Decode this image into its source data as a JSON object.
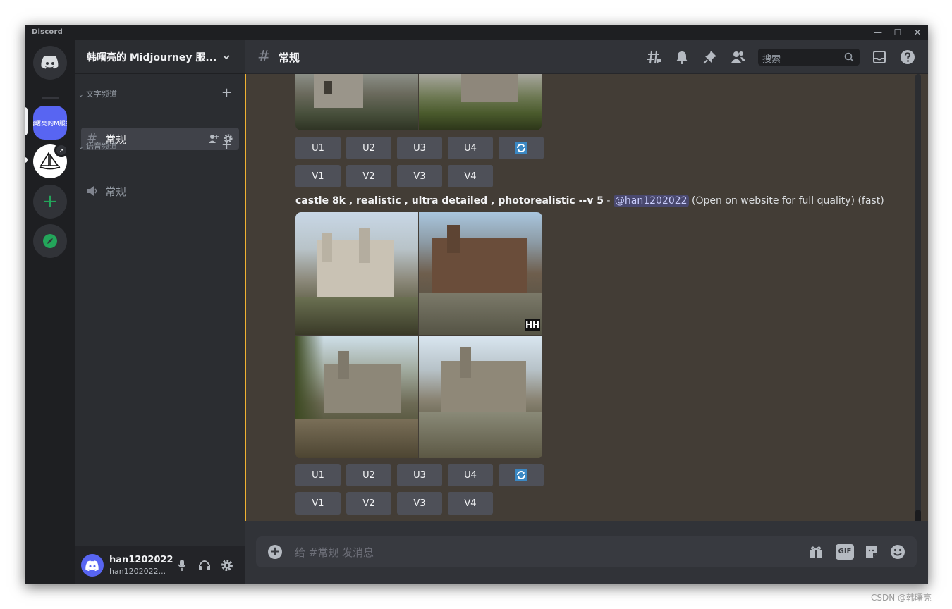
{
  "window": {
    "brand": "Discord",
    "controls": [
      "—",
      "☐",
      "✕"
    ]
  },
  "rail": {
    "servers": [
      {
        "kind": "home"
      },
      {
        "label": "翰曙亮的M服务"
      },
      {
        "kind": "midjourney"
      },
      {
        "kind": "add"
      },
      {
        "kind": "explore"
      }
    ]
  },
  "sidebar": {
    "guild_name": "韩曙亮的 Midjourney 服...",
    "categories": [
      {
        "label": "文字频道"
      },
      {
        "label": "语音频道"
      }
    ],
    "channels": [
      {
        "name": "常规",
        "type": "text",
        "selected": true
      },
      {
        "name": "常规",
        "type": "voice",
        "selected": false
      }
    ]
  },
  "user": {
    "name": "han1202022",
    "tag": "han1202022..."
  },
  "topbar": {
    "channel": "常规",
    "search_placeholder": "搜索"
  },
  "messages": [
    {
      "buttons_u": [
        "U1",
        "U2",
        "U3",
        "U4"
      ],
      "buttons_v": [
        "V1",
        "V2",
        "V3",
        "V4"
      ]
    },
    {
      "prompt": "castle 8k , realistic , ultra detailed , photorealistic --v 5",
      "separator": " - ",
      "mention": "@han1202022",
      "suffix": " (Open on website for full quality) (fast)",
      "watermark": "HH",
      "buttons_u": [
        "U1",
        "U2",
        "U3",
        "U4"
      ],
      "buttons_v": [
        "V1",
        "V2",
        "V3",
        "V4"
      ]
    }
  ],
  "composer": {
    "placeholder": "给 #常规 发消息",
    "gif_label": "GIF"
  },
  "footer_credit": "CSDN @韩曙亮",
  "colors": {
    "blurple": "#5865f2",
    "highlight_bar": "#f0b232",
    "green": "#23a55a"
  }
}
